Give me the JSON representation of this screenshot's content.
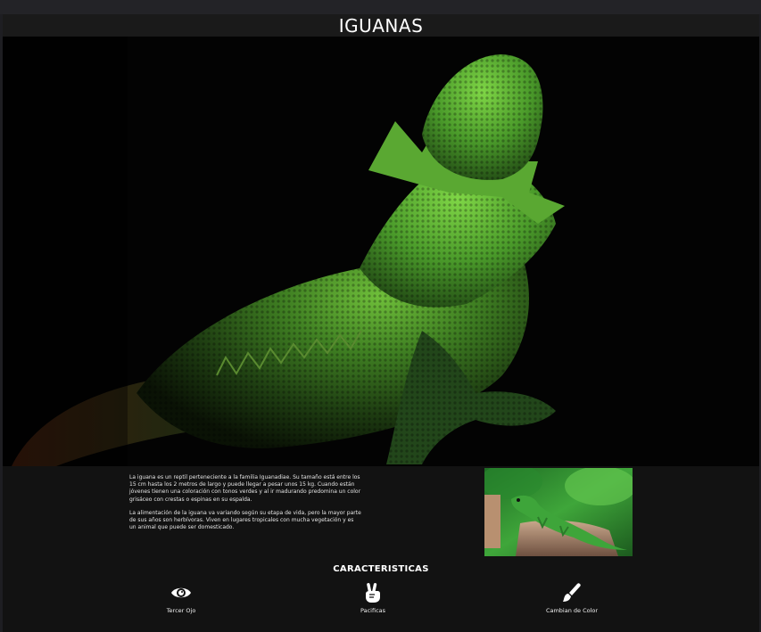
{
  "header": {
    "title": "IGUANAS"
  },
  "hero": {
    "image": "bearded-dragon-photo"
  },
  "intro": {
    "paragraphs": [
      "La iguana es un reptil perteneciente a la familia Iguanadiae. Su tamaño está entre los 15 cm hasta los 2 metros de largo y puede llegar a pesar unos 15 kg. Cuando están jóvenes tienen una coloración con tonos verdes y al ir madurando predomina un color grisáceo con crestas o espinas en su espalda.",
      "La alimentación de la iguana va variando según su etapa de vida, pero la mayor parte de sus años son herbívoras. Viven en lugares tropicales con mucha vegetación y es un animal que puede ser domesticado."
    ],
    "thumbnail": "green-iguana-on-stump-photo"
  },
  "features": {
    "title": "CARACTERISTICAS",
    "items": [
      {
        "label": "Tercer Ojo",
        "icon": "eye-icon"
      },
      {
        "label": "Pacificas",
        "icon": "peace-hand-icon"
      },
      {
        "label": "Cambian de Color",
        "icon": "paintbrush-icon"
      }
    ]
  },
  "colors": {
    "background": "#121212",
    "header_bg": "#1a1a1a",
    "text": "#ffffff"
  }
}
